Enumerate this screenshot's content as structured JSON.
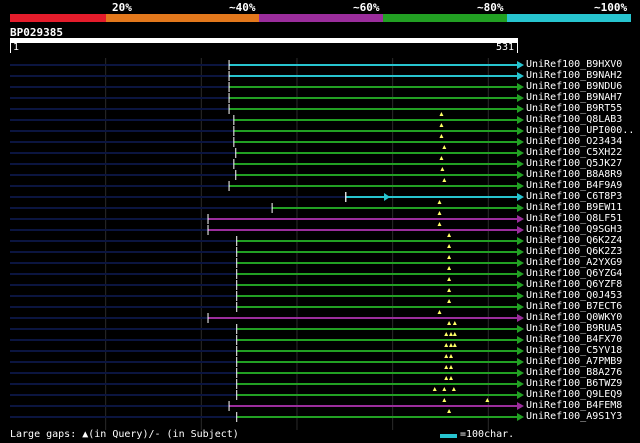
{
  "legend": {
    "segments": [
      {
        "label": "20%",
        "color": "#e51c2b"
      },
      {
        "label": "~40%",
        "color": "#e3781c"
      },
      {
        "label": "~60%",
        "color": "#9b2d9c"
      },
      {
        "label": "~80%",
        "color": "#22a023"
      },
      {
        "label": "~100%",
        "color": "#27c4cf"
      }
    ]
  },
  "query": {
    "id": "BP029385",
    "start": "1",
    "end": "531",
    "length": 531
  },
  "footer": {
    "gaps_text": "Large gaps: ▲(in Query)/- (in Subject)",
    "scale_text": "=100char."
  },
  "hits": [
    {
      "name": "UniRef100_B9HXV0",
      "start": 230,
      "end": 531,
      "color": "cyan",
      "gaps": []
    },
    {
      "name": "UniRef100_B9NAH2",
      "start": 230,
      "end": 531,
      "color": "cyan",
      "gaps": []
    },
    {
      "name": "UniRef100_B9NDU6",
      "start": 230,
      "end": 531,
      "color": "green",
      "gaps": []
    },
    {
      "name": "UniRef100_B9NAH7",
      "start": 230,
      "end": 531,
      "color": "green",
      "gaps": []
    },
    {
      "name": "UniRef100_B9RT55",
      "start": 230,
      "end": 531,
      "color": "green",
      "gaps": []
    },
    {
      "name": "UniRef100_Q8LAB3",
      "start": 235,
      "end": 531,
      "color": "green",
      "gaps": [
        452
      ]
    },
    {
      "name": "UniRef100_UPI000..",
      "start": 235,
      "end": 531,
      "color": "green",
      "gaps": [
        452
      ]
    },
    {
      "name": "UniRef100_O23434",
      "start": 235,
      "end": 531,
      "color": "green",
      "gaps": [
        452
      ]
    },
    {
      "name": "UniRef100_C5XH22",
      "start": 237,
      "end": 531,
      "color": "green",
      "gaps": [
        455
      ]
    },
    {
      "name": "UniRef100_Q5JK27",
      "start": 235,
      "end": 531,
      "color": "green",
      "gaps": [
        452
      ]
    },
    {
      "name": "UniRef100_B8A8R9",
      "start": 237,
      "end": 531,
      "color": "green",
      "gaps": [
        453
      ]
    },
    {
      "name": "UniRef100_B4F9A9",
      "start": 230,
      "end": 531,
      "color": "green",
      "gaps": [
        455
      ]
    },
    {
      "name": "UniRef100_C6T8P3",
      "start": 352,
      "end": 531,
      "color": "cyan",
      "gaps": [],
      "subject_gap": [
        352,
        392
      ]
    },
    {
      "name": "UniRef100_B9EW11",
      "start": 275,
      "end": 531,
      "color": "green",
      "gaps": [
        450
      ]
    },
    {
      "name": "UniRef100_Q8LF51",
      "start": 208,
      "end": 531,
      "color": "purple",
      "gaps": [
        450
      ]
    },
    {
      "name": "UniRef100_Q9SGH3",
      "start": 208,
      "end": 531,
      "color": "purple",
      "gaps": [
        450
      ]
    },
    {
      "name": "UniRef100_Q6K2Z4",
      "start": 238,
      "end": 531,
      "color": "green",
      "gaps": [
        460
      ]
    },
    {
      "name": "UniRef100_Q6K2Z3",
      "start": 238,
      "end": 531,
      "color": "green",
      "gaps": [
        460
      ]
    },
    {
      "name": "UniRef100_A2YXG9",
      "start": 238,
      "end": 531,
      "color": "green",
      "gaps": [
        460
      ]
    },
    {
      "name": "UniRef100_Q6YZG4",
      "start": 238,
      "end": 531,
      "color": "green",
      "gaps": [
        460
      ]
    },
    {
      "name": "UniRef100_Q6YZF8",
      "start": 238,
      "end": 531,
      "color": "green",
      "gaps": [
        460
      ]
    },
    {
      "name": "UniRef100_Q0J453",
      "start": 238,
      "end": 531,
      "color": "green",
      "gaps": [
        460
      ]
    },
    {
      "name": "UniRef100_B7ECT6",
      "start": 238,
      "end": 531,
      "color": "green",
      "gaps": [
        460
      ]
    },
    {
      "name": "UniRef100_Q0WKY0",
      "start": 208,
      "end": 531,
      "color": "purple",
      "gaps": [
        450
      ]
    },
    {
      "name": "UniRef100_B9RUA5",
      "start": 238,
      "end": 531,
      "color": "green",
      "gaps": [
        460,
        466
      ]
    },
    {
      "name": "UniRef100_B4FX70",
      "start": 238,
      "end": 531,
      "color": "green",
      "gaps": [
        457,
        462,
        466
      ]
    },
    {
      "name": "UniRef100_C5YV18",
      "start": 238,
      "end": 531,
      "color": "green",
      "gaps": [
        457,
        462,
        466
      ]
    },
    {
      "name": "UniRef100_A7PMB9",
      "start": 238,
      "end": 531,
      "color": "green",
      "gaps": [
        457,
        462
      ]
    },
    {
      "name": "UniRef100_B8A276",
      "start": 238,
      "end": 531,
      "color": "green",
      "gaps": [
        457,
        462
      ]
    },
    {
      "name": "UniRef100_B6TWZ9",
      "start": 238,
      "end": 531,
      "color": "green",
      "gaps": [
        457,
        462
      ]
    },
    {
      "name": "UniRef100_Q9LEQ9",
      "start": 238,
      "end": 531,
      "color": "green",
      "gaps": [
        445,
        455,
        465
      ]
    },
    {
      "name": "UniRef100_B4FEM8",
      "start": 230,
      "end": 531,
      "color": "purple",
      "gaps": [
        455,
        500
      ]
    },
    {
      "name": "UniRef100_A9S1Y3",
      "start": 238,
      "end": 531,
      "color": "green",
      "gaps": [
        460
      ]
    }
  ],
  "colors": {
    "cyan": "#27c4cf",
    "green": "#22a023",
    "purple": "#9b2d9c",
    "grid": "#2a2a2a",
    "underline": "#0b1540",
    "gap": "#ffff66"
  }
}
